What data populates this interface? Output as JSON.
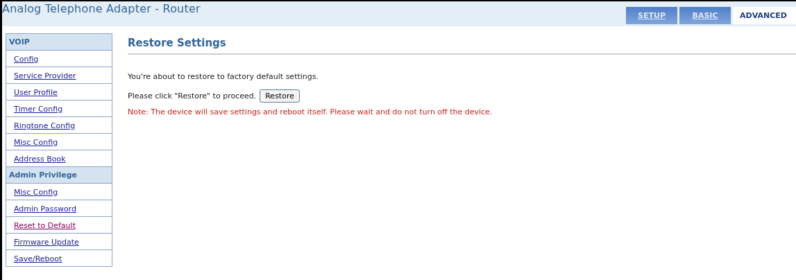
{
  "header": {
    "title": "Analog Telephone Adapter - Router"
  },
  "tabs": [
    {
      "label": "SETUP",
      "selected": false
    },
    {
      "label": "BASIC",
      "selected": false
    },
    {
      "label": "ADVANCED",
      "selected": true
    }
  ],
  "sidebar": {
    "sections": [
      {
        "title": "VOIP",
        "items": [
          {
            "label": "Config",
            "visited": false
          },
          {
            "label": "Service Provider",
            "visited": false
          },
          {
            "label": "User Profile",
            "visited": false
          },
          {
            "label": "Timer Config",
            "visited": false
          },
          {
            "label": "Ringtone Config",
            "visited": false
          },
          {
            "label": "Misc Config",
            "visited": false
          },
          {
            "label": "Address Book",
            "visited": false
          }
        ]
      },
      {
        "title": "Admin Privilege",
        "items": [
          {
            "label": "Misc Config",
            "visited": false
          },
          {
            "label": "Admin Password",
            "visited": false
          },
          {
            "label": "Reset to Default",
            "visited": true
          },
          {
            "label": "Firmware Update",
            "visited": false
          },
          {
            "label": "Save/Reboot",
            "visited": false
          }
        ]
      }
    ]
  },
  "content": {
    "heading": "Restore Settings",
    "message": "You're about to restore to factory default settings.",
    "prompt": "Please click \"Restore\" to proceed.",
    "button": "Restore",
    "note": "Note: The device will save settings and reboot itself. Please wait and do not turn off the device."
  }
}
